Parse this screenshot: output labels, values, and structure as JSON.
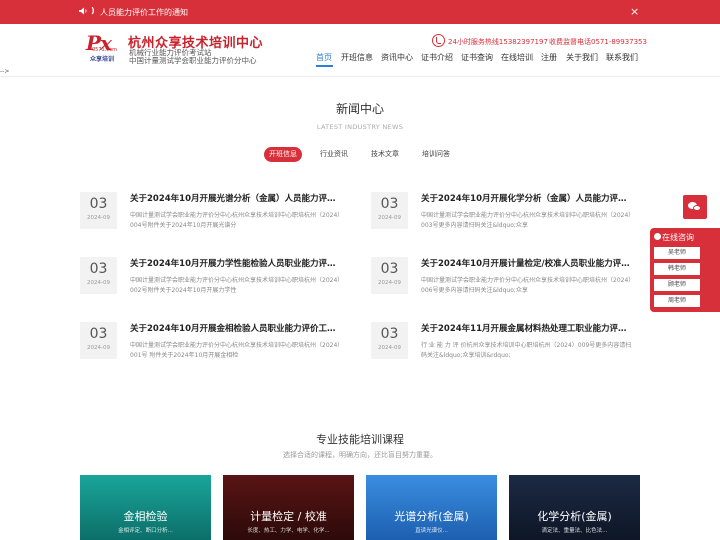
{
  "notice": {
    "arrow": ")",
    "text": "人员能力评价工作的通知",
    "close": "×"
  },
  "brand": {
    "logo_mark": "Px",
    "logo_small": "0571.com",
    "logo_sub": "众享培训",
    "title": "杭州众享技术培训中心",
    "line1": "机械行业能力评价考试站",
    "line2": "中国计量测试学会职业能力评价分中心"
  },
  "contact": {
    "hotline": "24小时服务热线15382397197",
    "supervise": "收费监督电话0571-89937353"
  },
  "nav": {
    "items": [
      "首页",
      "开班信息",
      "资讯中心",
      "证书介绍",
      "证书查询",
      "在线培训",
      "注册",
      "关于我们",
      "联系我们"
    ],
    "active_index": 0
  },
  "stray_text": "-->",
  "news": {
    "title": "新闻中心",
    "subtitle": "LATEST INDUSTRY NEWS",
    "tabs": [
      "开班信息",
      "行业资讯",
      "技术文章",
      "培训问答"
    ],
    "active_tab": 0,
    "items": [
      {
        "day": "03",
        "ym": "2024-09",
        "title": "关于2024年10月开展光谱分析（金属）人员能力评价工作的通知",
        "desc": "中国计量测试学会职业能力评价分中心杭州众享技术培训中心职培杭州（2024）004号附件关于2024年10月开展光谱分"
      },
      {
        "day": "03",
        "ym": "2024-09",
        "title": "关于2024年10月开展化学分析（金属）人员能力评价工作的通知",
        "desc": "中国计量测试学会职业能力评价分中心杭州众享技术培训中心职培杭州（2024）003号更多内容请扫码关注&ldquo;众享"
      },
      {
        "day": "03",
        "ym": "2024-09",
        "title": "关于2024年10月开展力学性能检验人员职业能力评价工作的通知",
        "desc": "中国计量测试学会职业能力评价分中心杭州众享技术培训中心职培杭州（2024）002号附件关于2024年10月开展力学性"
      },
      {
        "day": "03",
        "ym": "2024-09",
        "title": "关于2024年10月开展计量检定/校准人员职业能力评价工作的通知",
        "desc": "中国计量测试学会职业能力评价分中心杭州众享技术培训中心职培杭州（2024）006号更多内容请扫码关注&ldquo;众享"
      },
      {
        "day": "03",
        "ym": "2024-09",
        "title": "关于2024年10月开展金相检验人员职业能力评价工作的通知",
        "desc": "中国计量测试学会职业能力评价分中心杭州众享技术培训中心职培杭州（2024）001号 附件关于2024年10月开展金相检"
      },
      {
        "day": "03",
        "ym": "2024-09",
        "title": "关于2024年11月开展金属材料热处理工职业能力评价工作的通知",
        "desc": "行 业 能 力 评 价杭州众享技术培训中心职培杭州（2024）009号更多内容请扫码关注&ldquo;众享培训&rdquo;"
      }
    ]
  },
  "courses": {
    "title": "专业技能培训课程",
    "subtitle": "选择合适的课程，明确方向，还比盲目努力重要。",
    "cards": [
      {
        "name": "金相检验",
        "tags": "金相评定、断口分析..."
      },
      {
        "name": "计量检定 / 校准",
        "tags": "长度、热工、力学、电学、化学..."
      },
      {
        "name": "光谱分析(金属)",
        "tags": "直读光谱仪..."
      },
      {
        "name": "化学分析(金属)",
        "tags": "滴定法、重量法、比色法..."
      }
    ]
  },
  "sidebar": {
    "consult_label": "在线咨询",
    "advisors": [
      "吴老师",
      "韩老师",
      "顾老师",
      "周老师"
    ]
  }
}
